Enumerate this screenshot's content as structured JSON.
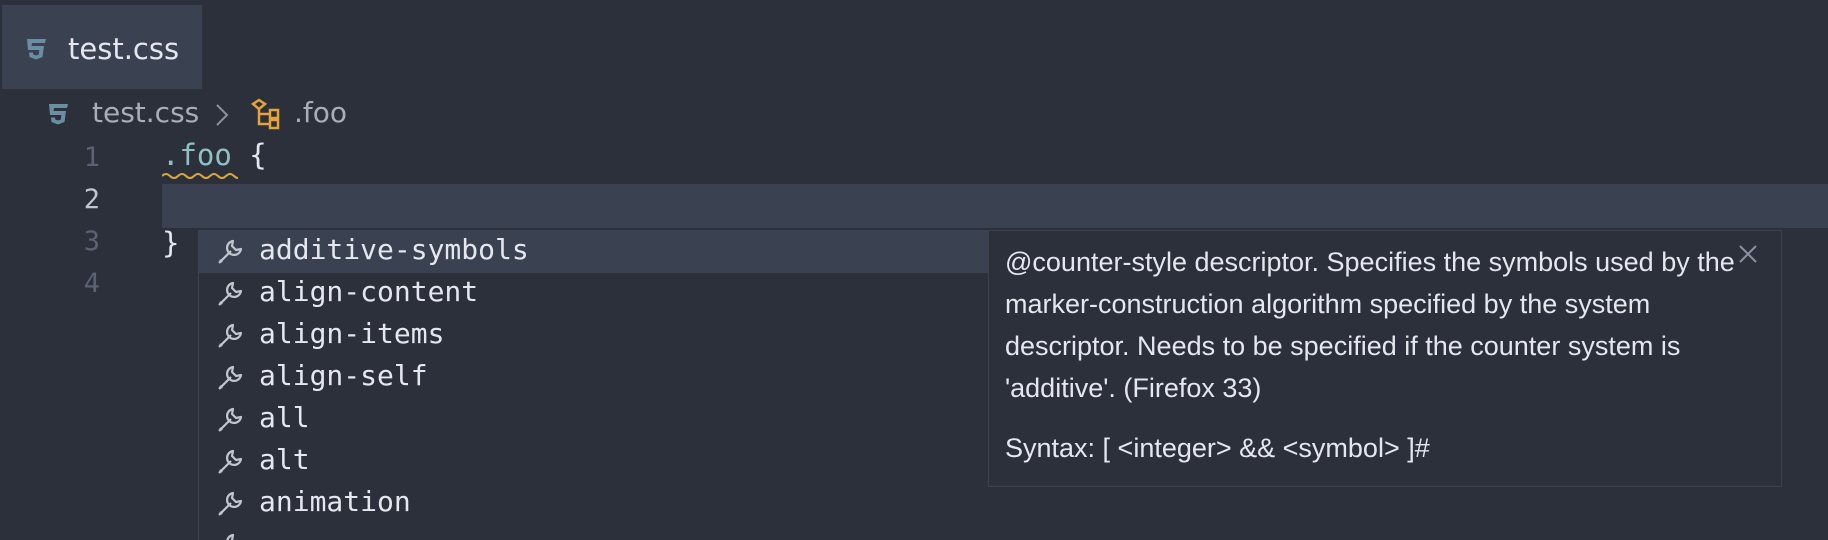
{
  "tab": {
    "label": "test.css",
    "icon": "css3-icon"
  },
  "breadcrumb": {
    "file": "test.css",
    "file_icon": "css3-icon",
    "separator_icon": "chevron-right-icon",
    "symbol": ".foo",
    "symbol_icon": "symbol-class-icon"
  },
  "editor": {
    "line_numbers": [
      "1",
      "2",
      "3",
      "4"
    ],
    "current_line": "2",
    "lines": [
      {
        "selector": ".foo",
        "brace": " {"
      },
      {
        "text": ""
      },
      {
        "brace": "}"
      },
      {
        "text": ""
      }
    ]
  },
  "suggest": {
    "item_icon": "wrench-icon",
    "items": [
      {
        "label": "additive-symbols",
        "selected": true
      },
      {
        "label": "align-content"
      },
      {
        "label": "align-items"
      },
      {
        "label": "align-self"
      },
      {
        "label": "all"
      },
      {
        "label": "alt"
      },
      {
        "label": "animation"
      }
    ]
  },
  "details": {
    "description": "@counter-style descriptor. Specifies the symbols used by the marker-construction algorithm specified by the system descriptor. Needs to be specified if the counter system is 'additive'. (Firefox 33)",
    "syntax": "Syntax: [ <integer> && <symbol> ]#",
    "close_icon": "close-icon"
  },
  "colors": {
    "background": "#2b303b",
    "active_background": "#3a4150",
    "selector": "#8fc1c3",
    "css_icon": "#6a8fa3",
    "symbol_icon": "#e6a23c",
    "squiggle": "#d8a840"
  }
}
